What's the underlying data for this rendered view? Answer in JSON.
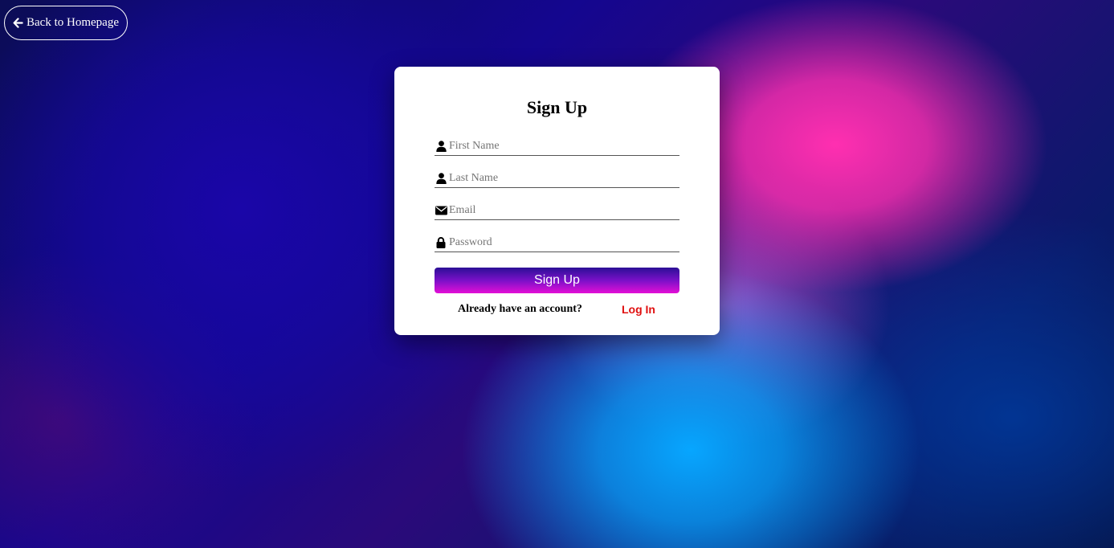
{
  "back_button": {
    "label": "Back to Homepage",
    "icon": "arrow-left-icon"
  },
  "form": {
    "title": "Sign Up",
    "fields": [
      {
        "name": "first_name",
        "icon": "user-icon",
        "placeholder": "First Name",
        "value": ""
      },
      {
        "name": "last_name",
        "icon": "user-icon",
        "placeholder": "Last Name",
        "value": ""
      },
      {
        "name": "email",
        "icon": "envelope-icon",
        "placeholder": "Email",
        "value": ""
      },
      {
        "name": "password",
        "icon": "lock-icon",
        "placeholder": "Password",
        "value": ""
      }
    ],
    "submit_label": "Sign Up",
    "account_question": "Already have an account?",
    "login_label": "Log In"
  },
  "colors": {
    "login_link": "#e01010",
    "button_gradient_top": "#2a0f96",
    "button_gradient_bottom": "#e40fd6"
  }
}
